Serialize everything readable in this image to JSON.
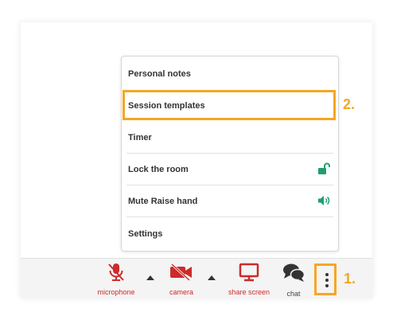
{
  "menu": {
    "items": [
      {
        "label": "Personal notes"
      },
      {
        "label": "Session templates"
      },
      {
        "label": "Timer"
      },
      {
        "label": "Lock the room",
        "icon": "unlocked-padlock-icon"
      },
      {
        "label": "Mute Raise hand",
        "icon": "speaker-on-icon"
      },
      {
        "label": "Settings"
      }
    ],
    "highlighted_index": 1
  },
  "annotations": {
    "step1": "1.",
    "step2": "2."
  },
  "toolbar": {
    "microphone_label": "microphone",
    "camera_label": "camera",
    "share_screen_label": "share screen",
    "chat_label": "chat"
  },
  "colors": {
    "accent_orange": "#f5a623",
    "muted_red": "#cc2b2b",
    "icon_green": "#1f9e6e"
  }
}
